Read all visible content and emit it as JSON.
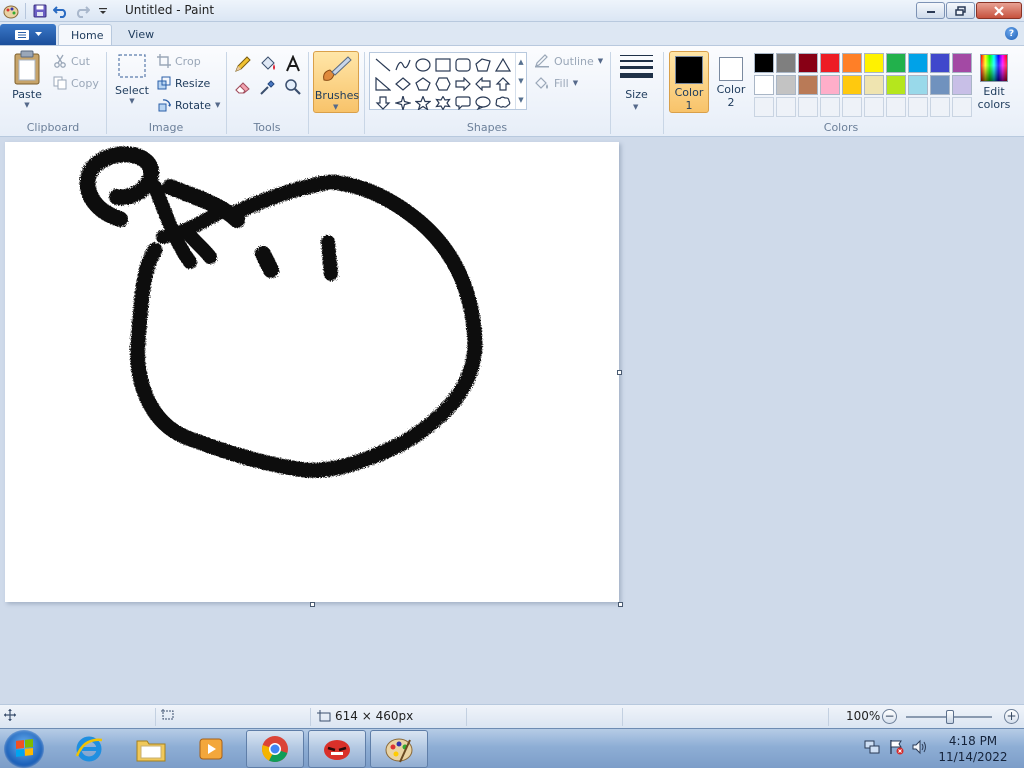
{
  "window": {
    "title": "Untitled - Paint"
  },
  "tabs": {
    "home": "Home",
    "view": "View"
  },
  "clipboard": {
    "group": "Clipboard",
    "paste": "Paste",
    "cut": "Cut",
    "copy": "Copy"
  },
  "image": {
    "group": "Image",
    "select": "Select",
    "crop": "Crop",
    "resize": "Resize",
    "rotate": "Rotate"
  },
  "tools": {
    "group": "Tools"
  },
  "brushes": {
    "label": "Brushes"
  },
  "shapes": {
    "group": "Shapes",
    "outline": "Outline",
    "fill": "Fill"
  },
  "size": {
    "label": "Size"
  },
  "colors": {
    "group": "Colors",
    "color1_line1": "Color",
    "color1_line2": "1",
    "color2_line1": "Color",
    "color2_line2": "2",
    "color1_value": "#000000",
    "color2_value": "#ffffff",
    "edit_line1": "Edit",
    "edit_line2": "colors",
    "palette_row1": [
      "#000000",
      "#7f7f7f",
      "#880015",
      "#ed1c24",
      "#ff7f27",
      "#fff200",
      "#22b14c",
      "#00a2e8",
      "#3f48cc",
      "#a349a4"
    ],
    "palette_row2": [
      "#ffffff",
      "#c3c3c3",
      "#b97a57",
      "#ffaec9",
      "#ffc90e",
      "#efe4b0",
      "#b5e61d",
      "#99d9ea",
      "#7092be",
      "#c8bfe7"
    ]
  },
  "status": {
    "image_size": "614 × 460px",
    "zoom": "100%"
  },
  "clock": {
    "time": "4:18 PM",
    "date": "11/14/2022"
  }
}
